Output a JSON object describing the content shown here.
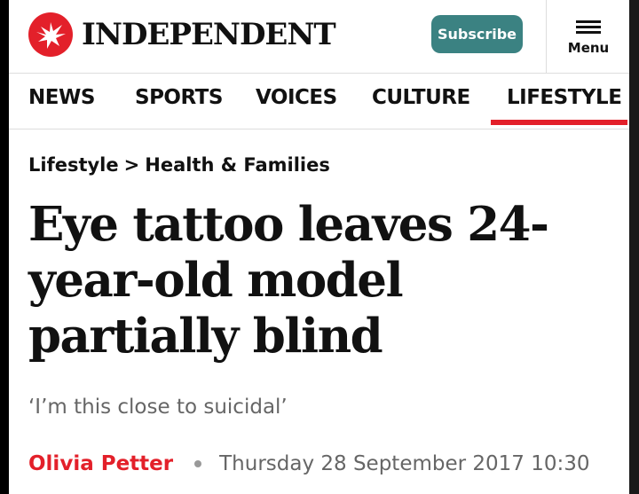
{
  "header": {
    "logo_text": "INDEPENDENT",
    "subscribe_label": "Subscribe",
    "menu_label": "Menu",
    "brand_color": "#e3202a",
    "subscribe_color": "#3b8282"
  },
  "nav": {
    "items": [
      {
        "label": "NEWS"
      },
      {
        "label": "SPORTS"
      },
      {
        "label": "VOICES"
      },
      {
        "label": "CULTURE"
      },
      {
        "label": "LIFESTYLE",
        "active": true
      }
    ]
  },
  "breadcrumb": {
    "section": "Lifestyle",
    "separator": ">",
    "subsection": "Health & Families"
  },
  "article": {
    "headline": "Eye tattoo leaves 24-year-old model partially blind",
    "standfirst": "‘I’m this close to suicidal’",
    "author": "Olivia Petter",
    "date": "Thursday 28 September 2017 10:30"
  }
}
